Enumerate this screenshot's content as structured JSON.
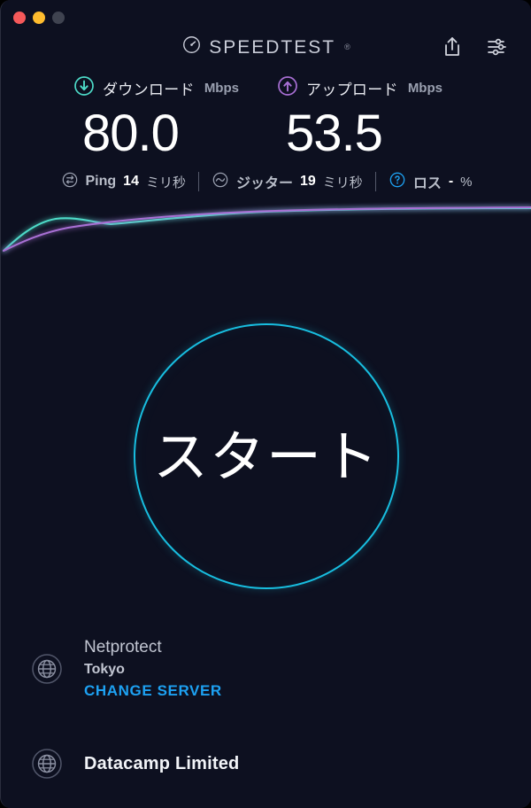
{
  "window": {
    "controls": [
      {
        "name": "close",
        "color": "#f5595a"
      },
      {
        "name": "minimize",
        "color": "#febc2e"
      },
      {
        "name": "zoom",
        "color": "#3f4350"
      }
    ]
  },
  "header": {
    "brand": "SPEEDTEST",
    "registered_mark": "®",
    "logo_icon": "speedometer-icon",
    "actions": [
      {
        "name": "share-icon",
        "label": "Share"
      },
      {
        "name": "settings-sliders-icon",
        "label": "Settings"
      }
    ]
  },
  "results": {
    "download": {
      "icon": "arrow-down-circle-icon",
      "label": "ダウンロード",
      "unit": "Mbps",
      "value": "80.0",
      "color": "#4ddbc8"
    },
    "upload": {
      "icon": "arrow-up-circle-icon",
      "label": "アップロード",
      "unit": "Mbps",
      "value": "53.5",
      "color": "#a86fd4"
    }
  },
  "substats": [
    {
      "icon": "ping-icon",
      "name": "Ping",
      "value": "14",
      "unit": "ミリ秒",
      "icon_color": "#9aa0b0"
    },
    {
      "icon": "jitter-icon",
      "name": "ジッター",
      "value": "19",
      "unit": "ミリ秒",
      "icon_color": "#9aa0b0"
    },
    {
      "icon": "question-circle-icon",
      "name": "ロス",
      "value": "-",
      "unit": "%",
      "icon_color": "#1da1f2"
    }
  ],
  "chart_data": {
    "type": "line",
    "title": "",
    "xlabel": "",
    "ylabel": "",
    "grid": false,
    "legend": "none",
    "x": [
      0,
      5,
      10,
      15,
      20,
      25,
      30,
      40,
      50,
      60,
      70,
      80,
      90,
      100
    ],
    "series": [
      {
        "name": "ダウンロード",
        "color": "#4ddbc8",
        "values": [
          0,
          30,
          58,
          66,
          66,
          64,
          66,
          72,
          78,
          80,
          80,
          80,
          80,
          80
        ]
      },
      {
        "name": "アップロード",
        "color": "#a86fd4",
        "values": [
          0,
          16,
          34,
          46,
          54,
          59,
          63,
          70,
          76,
          80,
          82,
          82,
          82,
          82
        ]
      }
    ],
    "ylim": [
      0,
      100
    ],
    "xlim": [
      0,
      100
    ]
  },
  "start_button": {
    "label": "スタート",
    "color": "#18bee0"
  },
  "server": {
    "icon": "globe-icon",
    "name": "Netprotect",
    "city": "Tokyo",
    "change_label": "CHANGE SERVER",
    "change_color": "#1da1f2"
  },
  "isp": {
    "icon": "globe-icon",
    "name": "Datacamp Limited"
  }
}
